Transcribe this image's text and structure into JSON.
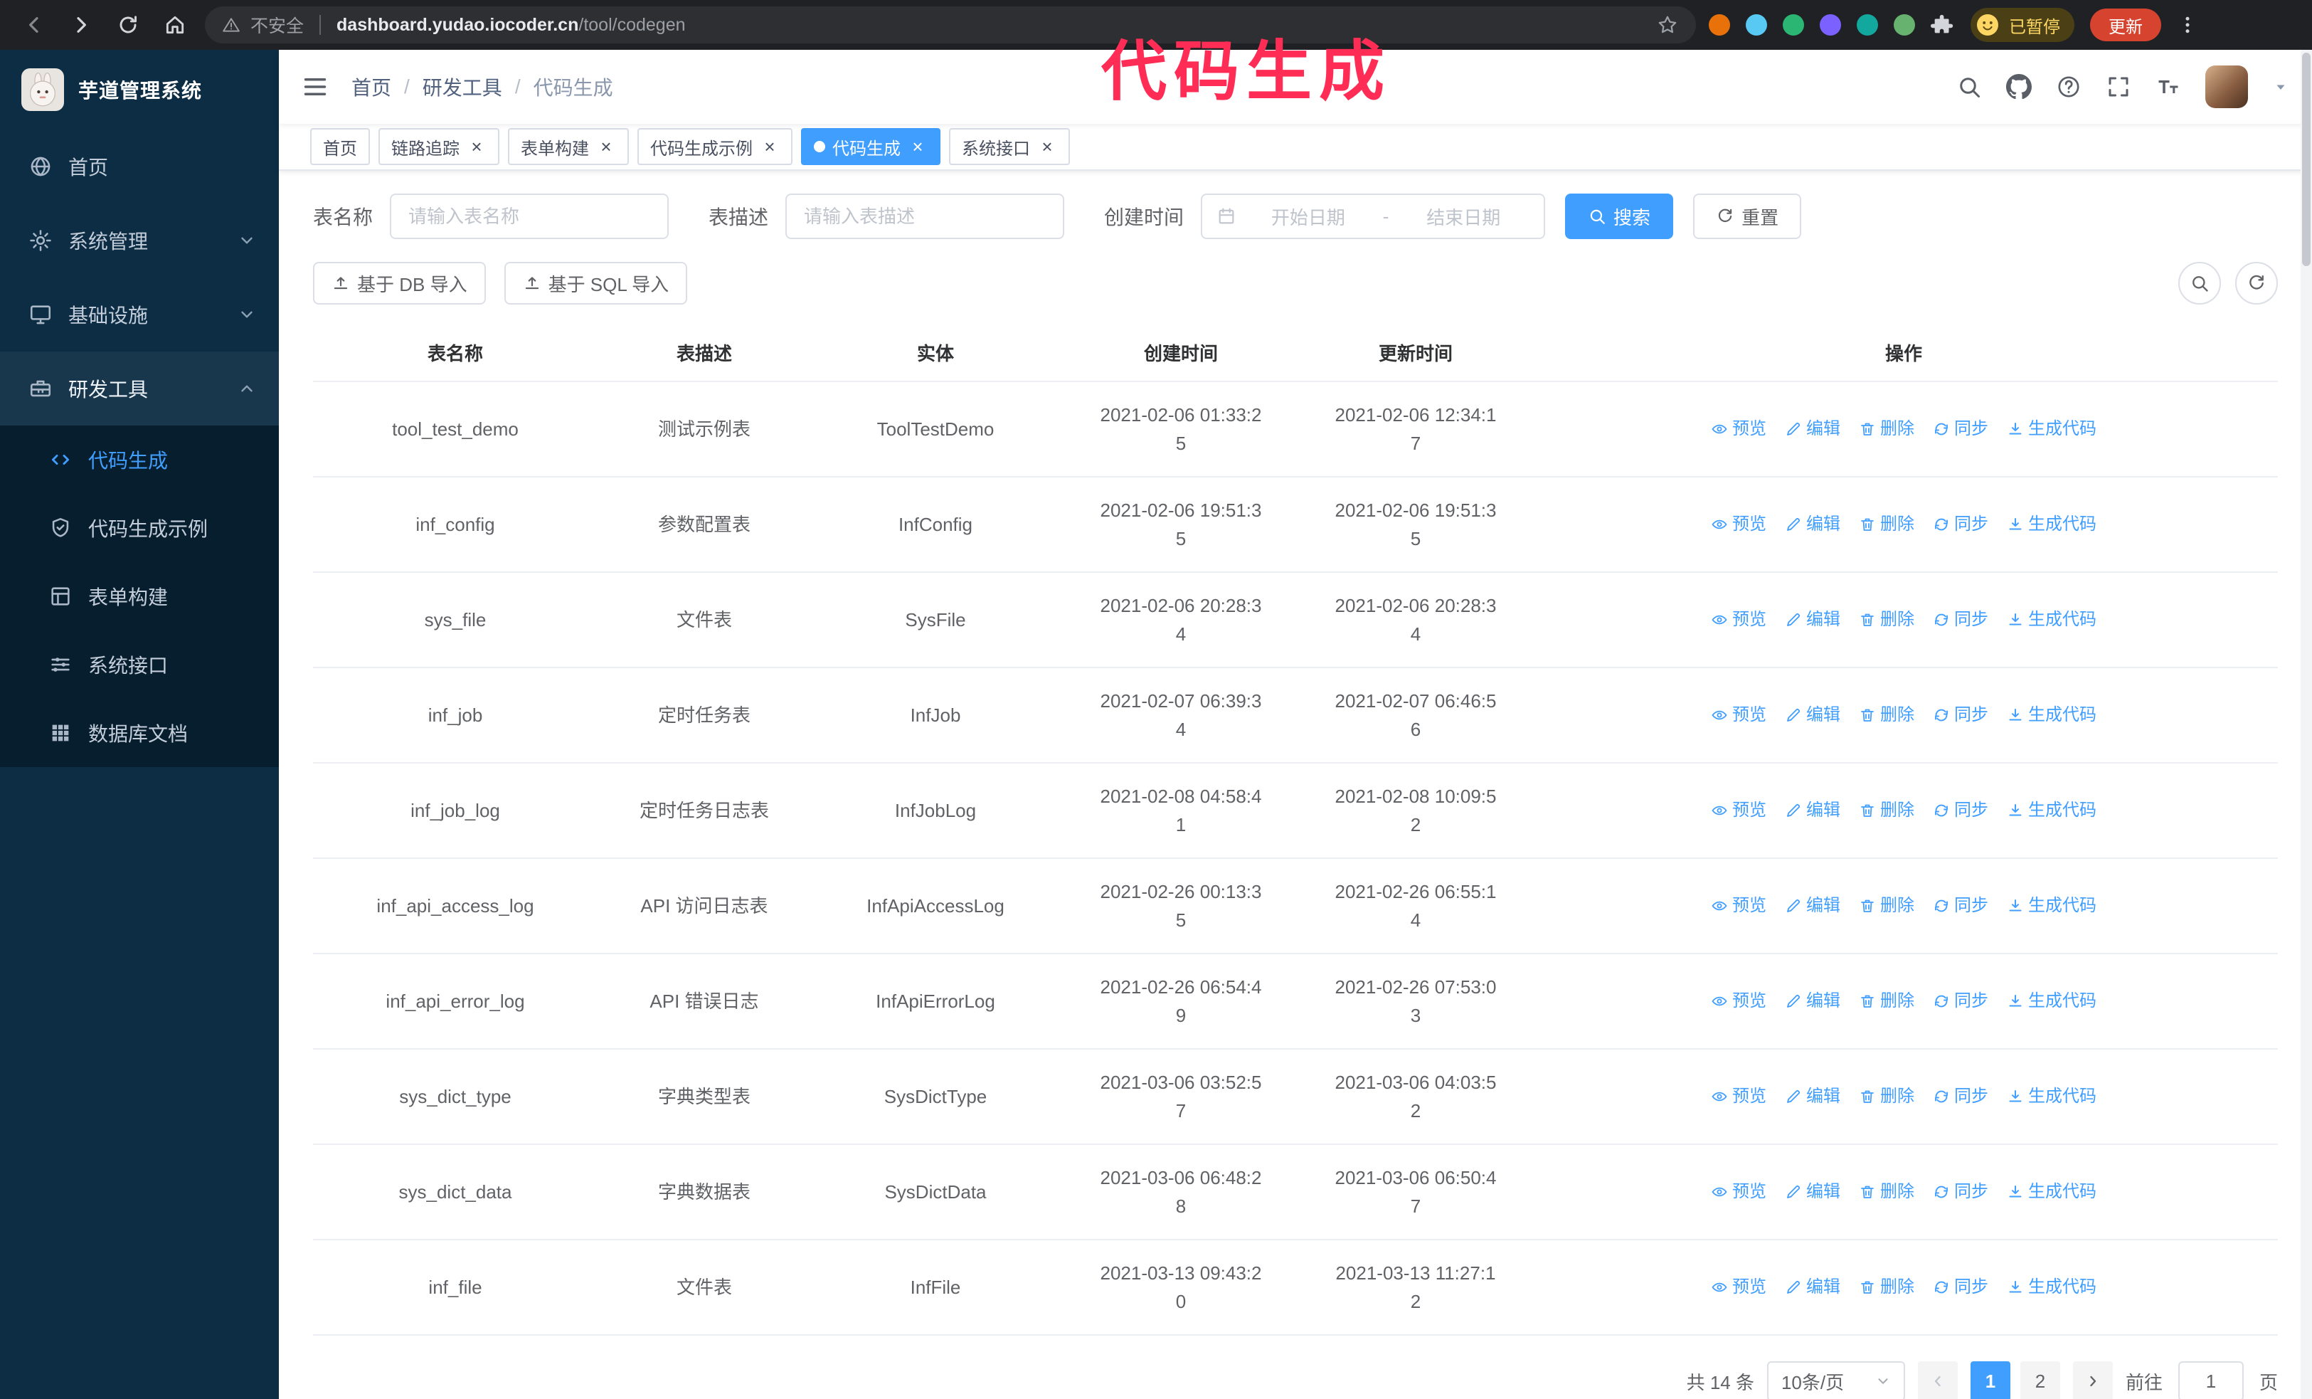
{
  "colors": {
    "accent": "#409eff",
    "annotation": "#ff2d55",
    "sidebar_bg": "#0c2d44"
  },
  "annotation": {
    "text": "代码生成"
  },
  "browser": {
    "security_label": "不安全",
    "url_domain": "dashboard.yudao.iocoder.cn",
    "url_path": "/tool/codegen",
    "extensions": [
      {
        "name": "orange-extension-icon",
        "color": "#e8710a"
      },
      {
        "name": "blue-extension-icon",
        "color": "#58c9f3"
      },
      {
        "name": "green-check-extension-icon",
        "color": "#2bb673"
      },
      {
        "name": "purple-extension-icon",
        "color": "#7b61ff"
      },
      {
        "name": "teal-extension-icon",
        "color": "#13a89e"
      },
      {
        "name": "leaf-extension-icon",
        "color": "#67b26f"
      }
    ],
    "profile_chip": "已暂停",
    "update_button": "更新"
  },
  "sidebar": {
    "logo_title": "芋道管理系统",
    "menu": [
      {
        "key": "home",
        "label": "首页",
        "icon": "globe-icon",
        "expandable": false,
        "expanded": false
      },
      {
        "key": "system",
        "label": "系统管理",
        "icon": "gear-icon",
        "expandable": true,
        "expanded": false
      },
      {
        "key": "infra",
        "label": "基础设施",
        "icon": "monitor-icon",
        "expandable": true,
        "expanded": false
      },
      {
        "key": "devtools",
        "label": "研发工具",
        "icon": "toolbox-icon",
        "expandable": true,
        "expanded": true
      }
    ],
    "submenu": [
      {
        "key": "codegen",
        "label": "代码生成",
        "icon": "code-icon",
        "active": true
      },
      {
        "key": "codegen-example",
        "label": "代码生成示例",
        "icon": "shield-icon",
        "active": false
      },
      {
        "key": "form-builder",
        "label": "表单构建",
        "icon": "form-icon",
        "active": false
      },
      {
        "key": "system-api",
        "label": "系统接口",
        "icon": "sliders-icon",
        "active": false
      },
      {
        "key": "db-doc",
        "label": "数据库文档",
        "icon": "grid-icon",
        "active": false
      }
    ]
  },
  "navbar": {
    "breadcrumb": [
      "首页",
      "研发工具",
      "代码生成"
    ]
  },
  "tags": [
    {
      "key": "home",
      "label": "首页",
      "closable": false,
      "active": false
    },
    {
      "key": "trace",
      "label": "链路追踪",
      "closable": true,
      "active": false
    },
    {
      "key": "form-builder",
      "label": "表单构建",
      "closable": true,
      "active": false
    },
    {
      "key": "codegen-example",
      "label": "代码生成示例",
      "closable": true,
      "active": false
    },
    {
      "key": "codegen",
      "label": "代码生成",
      "closable": true,
      "active": true
    },
    {
      "key": "system-api",
      "label": "系统接口",
      "closable": true,
      "active": false
    }
  ],
  "filters": {
    "table_name_label": "表名称",
    "table_name_placeholder": "请输入表名称",
    "table_desc_label": "表描述",
    "table_desc_placeholder": "请输入表描述",
    "create_time_label": "创建时间",
    "date_start_placeholder": "开始日期",
    "date_separator": "-",
    "date_end_placeholder": "结束日期",
    "search_button": "搜索",
    "reset_button": "重置"
  },
  "toolbar": {
    "import_db_label": "基于 DB 导入",
    "import_sql_label": "基于 SQL 导入"
  },
  "table": {
    "columns": [
      "表名称",
      "表描述",
      "实体",
      "创建时间",
      "更新时间",
      "操作"
    ],
    "action_labels": [
      "预览",
      "编辑",
      "删除",
      "同步",
      "生成代码"
    ],
    "rows": [
      {
        "name": "tool_test_demo",
        "desc": "测试示例表",
        "entity": "ToolTestDemo",
        "created": "2021-02-06 01:33:25",
        "updated": "2021-02-06 12:34:17"
      },
      {
        "name": "inf_config",
        "desc": "参数配置表",
        "entity": "InfConfig",
        "created": "2021-02-06 19:51:35",
        "updated": "2021-02-06 19:51:35"
      },
      {
        "name": "sys_file",
        "desc": "文件表",
        "entity": "SysFile",
        "created": "2021-02-06 20:28:34",
        "updated": "2021-02-06 20:28:34"
      },
      {
        "name": "inf_job",
        "desc": "定时任务表",
        "entity": "InfJob",
        "created": "2021-02-07 06:39:34",
        "updated": "2021-02-07 06:46:56"
      },
      {
        "name": "inf_job_log",
        "desc": "定时任务日志表",
        "entity": "InfJobLog",
        "created": "2021-02-08 04:58:41",
        "updated": "2021-02-08 10:09:52"
      },
      {
        "name": "inf_api_access_log",
        "desc": "API 访问日志表",
        "entity": "InfApiAccessLog",
        "created": "2021-02-26 00:13:35",
        "updated": "2021-02-26 06:55:14"
      },
      {
        "name": "inf_api_error_log",
        "desc": "API 错误日志",
        "entity": "InfApiErrorLog",
        "created": "2021-02-26 06:54:49",
        "updated": "2021-02-26 07:53:03"
      },
      {
        "name": "sys_dict_type",
        "desc": "字典类型表",
        "entity": "SysDictType",
        "created": "2021-03-06 03:52:57",
        "updated": "2021-03-06 04:03:52"
      },
      {
        "name": "sys_dict_data",
        "desc": "字典数据表",
        "entity": "SysDictData",
        "created": "2021-03-06 06:48:28",
        "updated": "2021-03-06 06:50:47"
      },
      {
        "name": "inf_file",
        "desc": "文件表",
        "entity": "InfFile",
        "created": "2021-03-13 09:43:20",
        "updated": "2021-03-13 11:27:12"
      }
    ]
  },
  "pagination": {
    "total_label": "共 14 条",
    "page_size_label": "10条/页",
    "pages": [
      "1",
      "2"
    ],
    "active_page": "1",
    "goto_prefix": "前往",
    "goto_value": "1",
    "goto_suffix": "页"
  }
}
